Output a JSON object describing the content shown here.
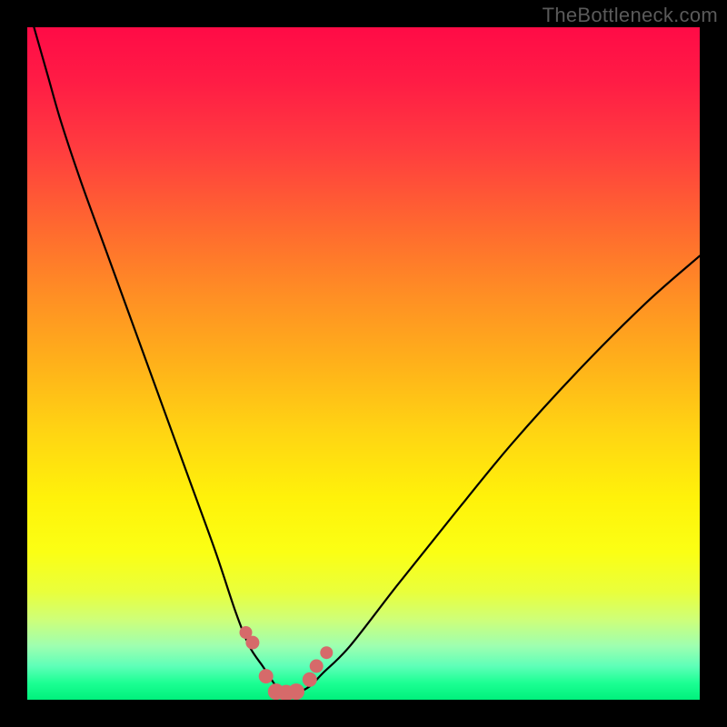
{
  "watermark": "TheBottleneck.com",
  "colors": {
    "frame": "#000000",
    "curve": "#000000",
    "marker": "#d66a6a",
    "gradient_top": "#ff0b46",
    "gradient_bottom": "#00f07c"
  },
  "chart_data": {
    "type": "line",
    "title": "",
    "xlabel": "",
    "ylabel": "",
    "xlim": [
      0,
      100
    ],
    "ylim": [
      0,
      100
    ],
    "curve": {
      "name": "bottleneck-curve",
      "x": [
        1,
        3,
        5,
        8,
        12,
        16,
        20,
        24,
        28,
        31,
        33,
        35,
        36,
        37,
        38,
        39,
        40,
        42,
        44,
        48,
        55,
        63,
        72,
        82,
        92,
        100
      ],
      "y": [
        100,
        93,
        86,
        77,
        66,
        55,
        44,
        33,
        22,
        13,
        8,
        5,
        3.5,
        2,
        1,
        1,
        1,
        2,
        4,
        8,
        17,
        27,
        38,
        49,
        59,
        66
      ]
    },
    "markers": {
      "name": "highlight-points",
      "x": [
        32.5,
        33.5,
        35.5,
        37,
        38.5,
        40,
        42,
        43,
        44.5
      ],
      "y": [
        10,
        8.5,
        3.5,
        1.2,
        1,
        1.2,
        3,
        5,
        7
      ],
      "r": [
        7,
        7.5,
        8,
        9,
        9,
        9,
        8,
        7.5,
        7
      ]
    }
  }
}
